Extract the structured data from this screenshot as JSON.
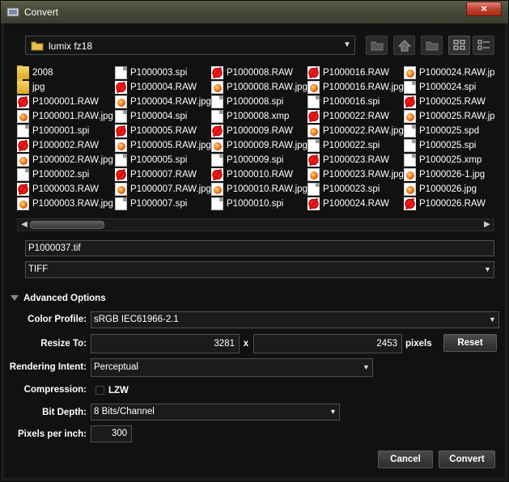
{
  "window": {
    "title": "Convert",
    "close_glyph": "×"
  },
  "location": {
    "label": "lumix fz18",
    "icons": [
      "folder-up-icon",
      "home-icon",
      "new-folder-icon",
      "icon-view-icon",
      "list-view-icon"
    ]
  },
  "files": [
    {
      "name": "2008",
      "type": "folder"
    },
    {
      "name": "jpg",
      "type": "folder"
    },
    {
      "name": "P1000001.RAW",
      "type": "raw"
    },
    {
      "name": "P1000001.RAW.jpg",
      "type": "jpg"
    },
    {
      "name": "P1000001.spi",
      "type": "doc"
    },
    {
      "name": "P1000002.RAW",
      "type": "raw"
    },
    {
      "name": "P1000002.RAW.jpg",
      "type": "jpg"
    },
    {
      "name": "P1000002.spi",
      "type": "doc"
    },
    {
      "name": "P1000003.RAW",
      "type": "raw"
    },
    {
      "name": "P1000003.RAW.jpg",
      "type": "jpg"
    },
    {
      "name": "P1000003.spi",
      "type": "doc"
    },
    {
      "name": "P1000004.RAW",
      "type": "raw"
    },
    {
      "name": "P1000004.RAW.jpg",
      "type": "jpg"
    },
    {
      "name": "P1000004.spi",
      "type": "doc"
    },
    {
      "name": "P1000005.RAW",
      "type": "raw"
    },
    {
      "name": "P1000005.RAW.jpg",
      "type": "jpg"
    },
    {
      "name": "P1000005.spi",
      "type": "doc"
    },
    {
      "name": "P1000007.RAW",
      "type": "raw"
    },
    {
      "name": "P1000007.RAW.jpg",
      "type": "jpg"
    },
    {
      "name": "P1000007.spi",
      "type": "doc"
    },
    {
      "name": "P1000008.RAW",
      "type": "raw"
    },
    {
      "name": "P1000008.RAW.jpg",
      "type": "jpg"
    },
    {
      "name": "P1000008.spi",
      "type": "doc"
    },
    {
      "name": "P1000008.xmp",
      "type": "doc"
    },
    {
      "name": "P1000009.RAW",
      "type": "raw"
    },
    {
      "name": "P1000009.RAW.jpg",
      "type": "jpg"
    },
    {
      "name": "P1000009.spi",
      "type": "doc"
    },
    {
      "name": "P1000010.RAW",
      "type": "raw"
    },
    {
      "name": "P1000010.RAW.jpg",
      "type": "jpg"
    },
    {
      "name": "P1000010.spi",
      "type": "doc"
    },
    {
      "name": "P1000016.RAW",
      "type": "raw"
    },
    {
      "name": "P1000016.RAW.jpg",
      "type": "jpg"
    },
    {
      "name": "P1000016.spi",
      "type": "doc"
    },
    {
      "name": "P1000022.RAW",
      "type": "raw"
    },
    {
      "name": "P1000022.RAW.jpg",
      "type": "jpg"
    },
    {
      "name": "P1000022.spi",
      "type": "doc"
    },
    {
      "name": "P1000023.RAW",
      "type": "raw"
    },
    {
      "name": "P1000023.RAW.jpg",
      "type": "jpg"
    },
    {
      "name": "P1000023.spi",
      "type": "doc"
    },
    {
      "name": "P1000024.RAW",
      "type": "raw"
    },
    {
      "name": "P1000024.RAW.jpg",
      "type": "jpg"
    },
    {
      "name": "P1000024.spi",
      "type": "doc"
    },
    {
      "name": "P1000025.RAW",
      "type": "raw"
    },
    {
      "name": "P1000025.RAW.jpg",
      "type": "jpg"
    },
    {
      "name": "P1000025.spd",
      "type": "doc"
    },
    {
      "name": "P1000025.spi",
      "type": "doc"
    },
    {
      "name": "P1000025.xmp",
      "type": "doc"
    },
    {
      "name": "P1000026-1.jpg",
      "type": "jpg"
    },
    {
      "name": "P1000026.jpg",
      "type": "jpg"
    },
    {
      "name": "P1000026.RAW",
      "type": "raw"
    }
  ],
  "filename": "P1000037.tif",
  "format": "TIFF",
  "advanced": {
    "header": "Advanced Options",
    "color_profile_label": "Color Profile:",
    "color_profile": "sRGB IEC61966-2.1",
    "resize_label": "Resize To:",
    "width": "3281",
    "x_label": "x",
    "height": "2453",
    "units": "pixels",
    "reset": "Reset",
    "intent_label": "Rendering Intent:",
    "intent": "Perceptual",
    "compression_label": "Compression:",
    "lzw": "LZW",
    "lzw_checked": false,
    "bitdepth_label": "Bit Depth:",
    "bitdepth": "8 Bits/Channel",
    "ppi_label": "Pixels per inch:",
    "ppi": "300"
  },
  "buttons": {
    "cancel": "Cancel",
    "convert": "Convert"
  }
}
